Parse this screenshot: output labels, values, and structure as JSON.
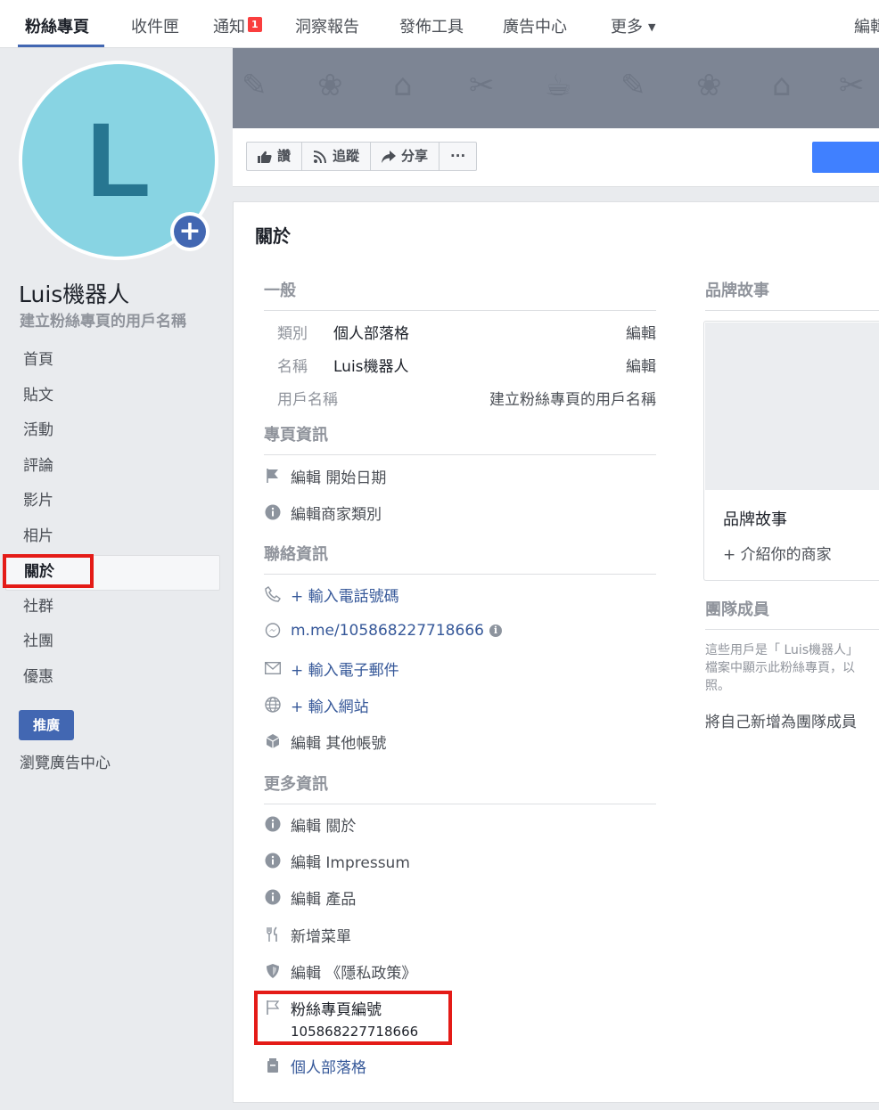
{
  "tabs": [
    {
      "label": "粉絲專頁",
      "active": true
    },
    {
      "label": "收件匣"
    },
    {
      "label": "通知",
      "badge": "1"
    },
    {
      "label": "洞察報告"
    },
    {
      "label": "發佈工具"
    },
    {
      "label": "廣告中心"
    },
    {
      "label": "更多",
      "caret": "▼"
    },
    {
      "label": "編輯"
    }
  ],
  "profile": {
    "letter": "L",
    "name": "Luis機器人",
    "username_prompt": "建立粉絲專頁的用戶名稱"
  },
  "sidebar": {
    "items": [
      "首頁",
      "貼文",
      "活動",
      "評論",
      "影片",
      "相片",
      "關於",
      "社群",
      "社團",
      "優惠"
    ],
    "active_index": 6,
    "promote_label": "推廣",
    "ads_link": "瀏覽廣告中心"
  },
  "actions": {
    "like": "讚",
    "follow": "追蹤",
    "share": "分享",
    "more": "···"
  },
  "about": {
    "title": "關於",
    "general": {
      "heading": "一般",
      "rows": [
        {
          "label": "類別",
          "value": "個人部落格",
          "action": "編輯"
        },
        {
          "label": "名稱",
          "value": "Luis機器人",
          "action": "編輯"
        },
        {
          "label": "用戶名稱",
          "value": "",
          "action": "建立粉絲專頁的用戶名稱"
        }
      ]
    },
    "page_info": {
      "heading": "專頁資訊",
      "items": [
        "編輯 開始日期",
        "編輯商家類別"
      ]
    },
    "contact": {
      "heading": "聯絡資訊",
      "items": [
        "+ 輸入電話號碼",
        "m.me/105868227718666",
        "+ 輸入電子郵件",
        "+ 輸入網站",
        "編輯 其他帳號"
      ]
    },
    "more_info": {
      "heading": "更多資訊",
      "items": [
        "編輯 關於",
        "編輯 Impressum",
        "編輯 產品",
        "新增菜單",
        "編輯 《隱私政策》",
        "粉絲專頁編號",
        "個人部落格"
      ],
      "page_id": "105868227718666"
    }
  },
  "right": {
    "brand_story_heading": "品牌故事",
    "brand_story_title": "品牌故事",
    "brand_story_link": "+ 介紹你的商家",
    "team_heading": "團隊成員",
    "team_desc_lines": [
      "這些用戶是「 Luis機器人」",
      "檔案中顯示此粉絲專頁，以",
      "照。"
    ],
    "team_link": "將自己新增為團隊成員"
  },
  "colors": {
    "accent": "#4267b2",
    "highlight": "#e41b17",
    "cta": "#4080ff",
    "avatar_bg": "#88d4e3",
    "avatar_letter": "#277691"
  }
}
